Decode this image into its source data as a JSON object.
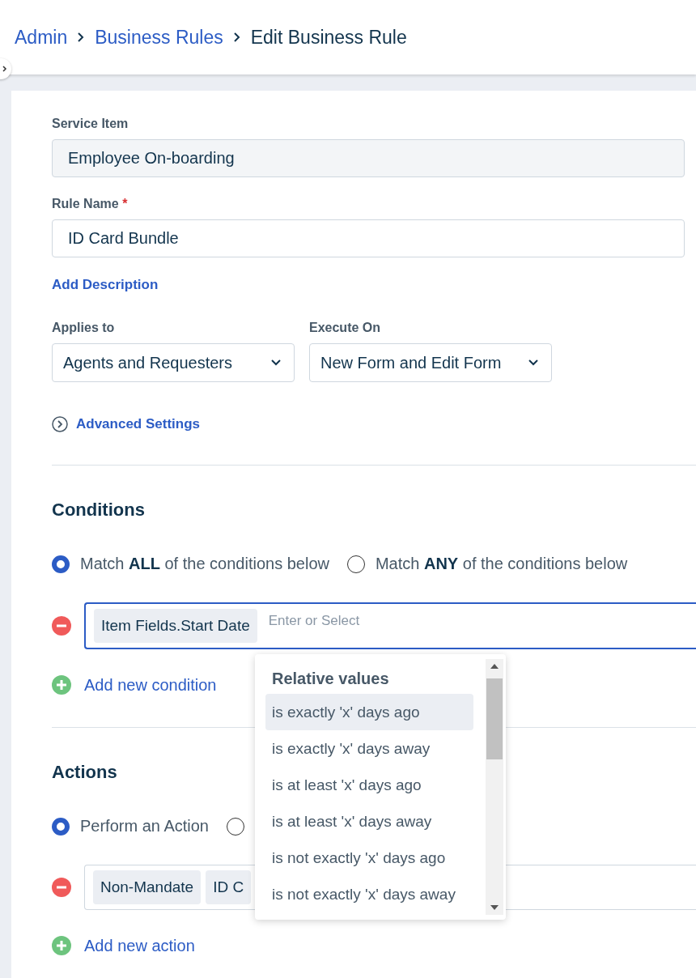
{
  "breadcrumb": [
    {
      "label": "Admin",
      "link": true
    },
    {
      "label": "Business Rules",
      "link": true
    },
    {
      "label": "Edit Business Rule",
      "link": false
    }
  ],
  "service_item": {
    "label": "Service Item",
    "value": "Employee On-boarding",
    "disabled": true
  },
  "rule_name": {
    "label": "Rule Name",
    "required_mark": "*",
    "value": "ID Card Bundle"
  },
  "add_description": "Add Description",
  "selects": [
    {
      "label": "Applies to",
      "value": "Agents and Requesters"
    },
    {
      "label": "Execute On",
      "value": "New Form and Edit Form"
    }
  ],
  "advanced_settings": {
    "label": "Advanced Settings",
    "expanded": false
  },
  "conditions": {
    "title": "Conditions",
    "match": [
      {
        "label": "Match **ALL** of the conditions below",
        "selected": true
      },
      {
        "label": "Match **ANY** of the conditions below",
        "selected": false
      }
    ],
    "rows": [
      {
        "chips": [
          "Item Fields.Start Date"
        ],
        "placeholder": "Enter or Select",
        "focused": true
      }
    ],
    "add": "Add new condition"
  },
  "actions": {
    "title": "Actions",
    "mode": [
      {
        "label": "Perform an Action",
        "selected": true
      },
      {
        "selected": false
      }
    ],
    "rows": [
      {
        "chips": [
          "Non-Mandate",
          "ID C"
        ],
        "placeholder": "",
        "focused": false
      }
    ],
    "add": "Add new action"
  },
  "dropdown": {
    "group": "Relative values",
    "options": [
      {
        "label": "is exactly 'x' days ago",
        "selected": true
      },
      {
        "label": "is exactly 'x' days away",
        "selected": false
      },
      {
        "label": "is at least 'x' days ago",
        "selected": false
      },
      {
        "label": "is at least 'x' days away",
        "selected": false
      },
      {
        "label": "is not exactly 'x' days ago",
        "selected": false
      },
      {
        "label": "is not exactly 'x' days away",
        "selected": false
      }
    ]
  }
}
